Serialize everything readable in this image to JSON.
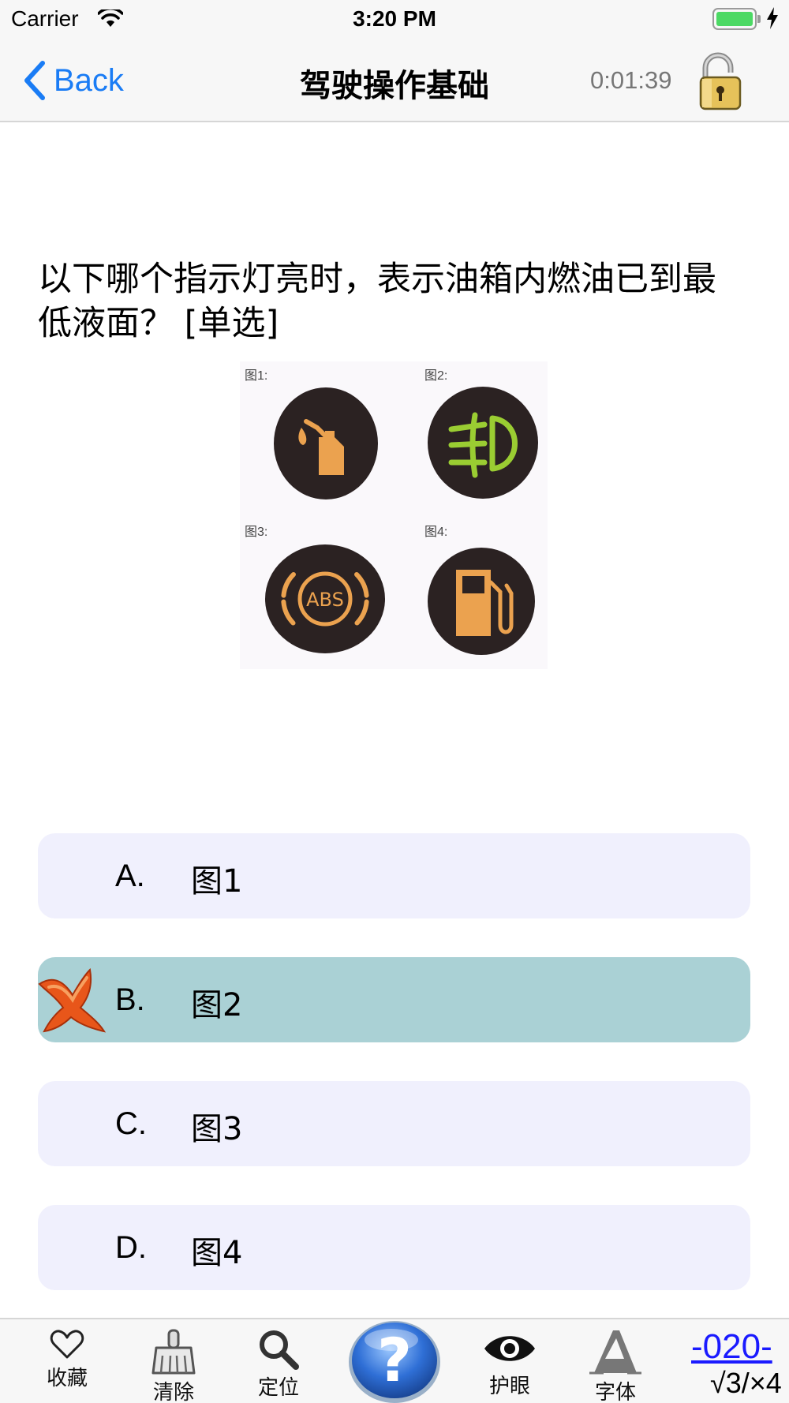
{
  "status_bar": {
    "carrier": "Carrier",
    "time": "3:20 PM"
  },
  "nav": {
    "back_label": "Back",
    "title": "驾驶操作基础",
    "timer": "0:01:39"
  },
  "question": {
    "text": "以下哪个指示灯亮时，表示油箱内燃油已到最低液面？ [单选]",
    "image_labels": [
      "图1:",
      "图2:",
      "图3:",
      "图4:"
    ],
    "abs_text": "ABS"
  },
  "options": [
    {
      "letter": "A.",
      "text": "图1",
      "selected": false
    },
    {
      "letter": "B.",
      "text": "图2",
      "selected": true
    },
    {
      "letter": "C.",
      "text": "图3",
      "selected": false
    },
    {
      "letter": "D.",
      "text": "图4",
      "selected": false
    }
  ],
  "toolbar": {
    "favorite_label": "收藏",
    "clear_label": "清除",
    "locate_label": "定位",
    "eye_label": "护眼",
    "font_label": "字体",
    "counter_number": "-020-",
    "counter_score": "√3/×4"
  },
  "colors": {
    "accent": "#1a7cf5",
    "option_bg": "#f0f0fd",
    "option_selected_bg": "#aad1d5",
    "counter_link": "#1a1aff"
  },
  "icons": [
    "wifi-icon",
    "battery-icon",
    "charging-bolt-icon",
    "back-chevron-icon",
    "lock-icon",
    "wrong-mark-icon",
    "heart-icon",
    "broom-icon",
    "magnifier-icon",
    "help-icon",
    "eye-icon",
    "font-a-icon"
  ]
}
